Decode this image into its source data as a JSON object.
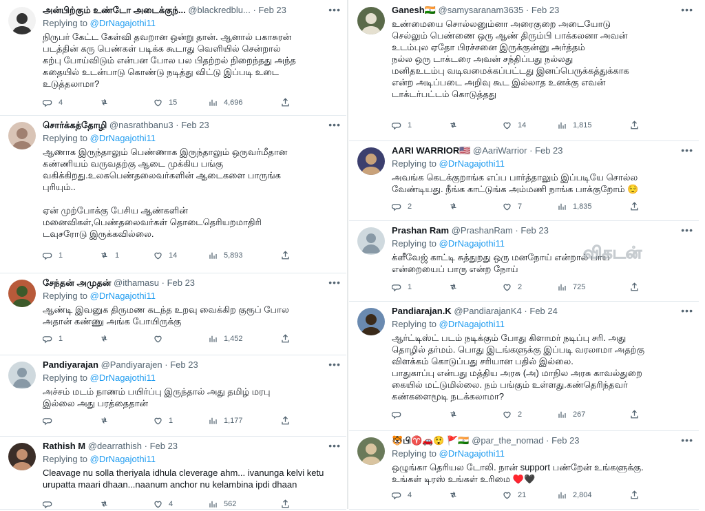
{
  "left_column": [
    {
      "name": "அன்பிற்கும் உண்டோ அடைக்குந்...",
      "handle": "@blackredblu...",
      "date": "Feb 23",
      "replying_prefix": "Replying to",
      "replying_to": "@DrNagajothi11",
      "text": "நிருபர் கேட்ட கேள்வி தவறான ஒன்று தான். ஆனால் பகாசுரன்\nபடத்தின் கரு பெண்கள் படிக்க கூடாது வெளியில் சென்றால்\nகற்பு போய்விடும் என்பன போல பல பிதற்றல் நிறைந்தது அந்த\nகதையில் உடன்பாடு கொண்டு நடித்து விட்டு இப்படி உடை\nஉடுத்தலாமா?",
      "stats": {
        "replies": "4",
        "retweets": "",
        "likes": "15",
        "views": "4,696"
      }
    },
    {
      "name": "சொர்க்கத்தோழி",
      "handle": "@nasrathbanu3",
      "date": "Feb 23",
      "replying_prefix": "Replying to",
      "replying_to": "@DrNagajothi11",
      "text": "ஆணாக இருந்தாலும் பெண்ணாக இருந்தாலும் ஒருவர்மீதான\nகண்ணியம் வருவதற்கு ஆடை முக்கிய பங்கு\nவகிக்கிறது.உலகபெண்தலைவர்களின் ஆடைகளை பாருங்க\nபுரியும்..\n\nஏன் முற்போக்கு பேசிய ஆண்களின்\nமனைவிகள்,பெண்தலைவர்கள் தொடைதெரியறமாதிரி\nடவுசரோடு இருக்கவில்லை.",
      "stats": {
        "replies": "1",
        "retweets": "1",
        "likes": "14",
        "views": "5,893"
      }
    },
    {
      "name": "சேந்தன் அமுதன்",
      "handle": "@ithamasu",
      "date": "Feb 23",
      "replying_prefix": "Replying to",
      "replying_to": "@DrNagajothi11",
      "text": "ஆண்டி இவனுக திருமண கடந்த உறவு வைக்கிற குரூப் போல\nஅதான் கண்ணு அங்க போயிருக்கு",
      "stats": {
        "replies": "1",
        "retweets": "",
        "likes": "",
        "views": "1,452"
      }
    },
    {
      "name": "Pandiyarajan",
      "handle": "@Pandiyarajen",
      "date": "Feb 23",
      "replying_prefix": "Replying to",
      "replying_to": "@DrNagajothi11",
      "text": "அச்சம் மடம் நாணம் பயிர்ப்பு இருந்தால் அது தமிழ் மரபு\nஇல்லை அது பரத்தைதான்",
      "stats": {
        "replies": "",
        "retweets": "",
        "likes": "1",
        "views": "1,177"
      }
    },
    {
      "name": "Rathish M",
      "handle": "@dearrathish",
      "date": "Feb 23",
      "replying_prefix": "Replying to",
      "replying_to": "@DrNagajothi11",
      "text": "Cleavage nu solla theriyala idhula cleverage ahm... ivanunga kelvi ketu\nurupatta maari dhaan...naanum anchor nu kelambina ipdi dhaan",
      "stats": {
        "replies": "",
        "retweets": "",
        "likes": "4",
        "views": "562"
      }
    }
  ],
  "right_column": [
    {
      "name": "Ganesh🇮🇳",
      "handle": "@samysaranam3635",
      "date": "Feb 23",
      "replying_prefix": "",
      "replying_to": "",
      "text": "உண்மையை சொல்லனும்னா அரைகுறை அடையோடு\nசெல்லும் பெண்ணை ஒரு ஆண் திரும்பி பாக்கலனா அவன்\nஉடம்புல ஏதோ பிரச்சனை இருக்குன்னு அர்த்தம்\nநல்ல ஒரு டாக்டரை அவன் சந்திப்பது நல்லது\nமனிதஉடம்பு வடிவமைக்கப்பட்டது இனப்பெருக்கத்துக்காக\nஎன்ற அடிப்படை அறிவு கூட இல்லாத உனக்கு எவன்\nடாக்டர்பட்டம் கொடுத்தது",
      "stats": {
        "replies": "1",
        "retweets": "",
        "likes": "14",
        "views": "1,815"
      }
    },
    {
      "name": "AARI WARRIOR🇺🇸",
      "handle": "@AariWarrior",
      "date": "Feb 23",
      "replying_prefix": "Replying to",
      "replying_to": "@DrNagajothi11",
      "text": "அவங்க கெடக்குறாங்க எப்ப பார்த்தாலும் இப்படியே சொல்ல\nவேண்டியது. நீங்க காட்டுங்க அம்மணி நாங்க பாக்குறோம் 😌",
      "stats": {
        "replies": "2",
        "retweets": "",
        "likes": "7",
        "views": "1,835"
      }
    },
    {
      "name": "Prashan Ram",
      "handle": "@PrashanRam",
      "date": "Feb 23",
      "replying_prefix": "Replying to",
      "replying_to": "@DrNagajothi11",
      "text": "க்ளீவேஜ் காட்டி சுத்துறது ஒரு மனநோய் என்றால் பாய\nஎன்றையைப் பாரு என்ற நோய்",
      "stats": {
        "replies": "1",
        "retweets": "",
        "likes": "2",
        "views": "725"
      }
    },
    {
      "name": "Pandiarajan.K",
      "handle": "@PandiarajanK4",
      "date": "Feb 24",
      "replying_prefix": "Replying to",
      "replying_to": "@DrNagajothi11",
      "text": "ஆர்ட்டிஸ்ட் படம் நடிக்கும் போது கிளாமர் நடிப்பு சரி. அது\nதொழில் தர்மம். பொது இடங்களுக்கு இப்படி வரலாமா அதற்கு\nவிளக்கம் கொடுப்பது சரியான பதில் இல்லை.\nபாதுகாப்பு என்பது மத்திய அரசு (அ) மாநில அரசு காவல்துறை\nகையில் மட்டுமில்லை. நம் பங்கும் உள்ளது.கண்தெரிந்தவர்\nகண்களைமூடி நடக்கலாமா?",
      "stats": {
        "replies": "",
        "retweets": "",
        "likes": "2",
        "views": "267"
      }
    },
    {
      "name": "🐯பி♈🚗😲 🚩🇮🇳",
      "handle": "@par_the_nomad",
      "date": "Feb 23",
      "replying_prefix": "Replying to",
      "replying_to": "@DrNagajothi11",
      "text": "ஒழுங்கா தெரியல டோலி. நான் support பண்றேன் உங்களுக்கு.\nஉங்கள் டிரஸ் உங்கள் உரிமை ♥️🖤",
      "stats": {
        "replies": "4",
        "retweets": "",
        "likes": "21",
        "views": "2,804"
      }
    }
  ],
  "watermark": "விகடன்",
  "colors": {
    "link": "#1d9bf0",
    "muted": "#536471",
    "text": "#0f1419",
    "border": "#e1e8ed"
  },
  "icons": [
    "more-icon",
    "reply-icon",
    "retweet-icon",
    "like-icon",
    "views-icon",
    "share-icon"
  ]
}
